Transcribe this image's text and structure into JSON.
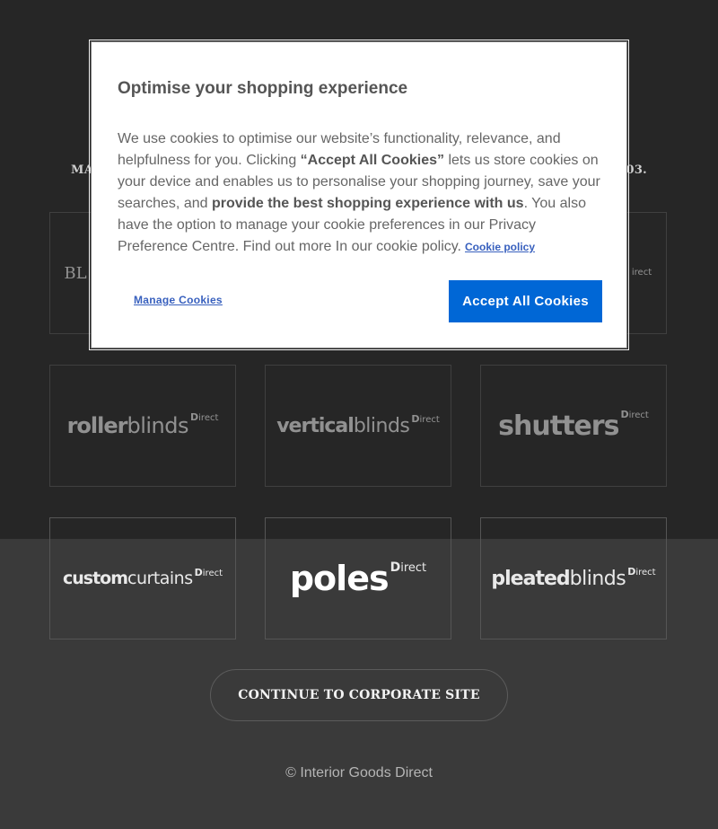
{
  "intro": {
    "left_fragment": "MA",
    "right_fragment": "03."
  },
  "brands": [
    {
      "strong": "BL",
      "light": "",
      "direct": "",
      "dim": true
    },
    {
      "strong": "",
      "light": "",
      "direct": "irect",
      "dim": true
    },
    {
      "strong": "roller",
      "light": "blinds",
      "direct": "irect",
      "dim": true
    },
    {
      "strong": "vertical",
      "light": "blinds",
      "direct": "irect",
      "dim": true
    },
    {
      "strong": "shutters",
      "light": "",
      "direct": "irect",
      "dim": true
    },
    {
      "strong": "custom",
      "light": "curtains",
      "direct": "irect",
      "dim": false
    },
    {
      "strong": "poles",
      "light": "",
      "direct": "irect",
      "dim": false
    },
    {
      "strong": "pleated",
      "light": "blinds",
      "direct": "irect",
      "dim": false
    }
  ],
  "continue_label": "CONTINUE TO CORPORATE SITE",
  "footer_copyright": "© Interior Goods Direct",
  "cookie_banner": {
    "title": "Optimise your shopping experience",
    "text_1": "We use cookies to optimise our website’s functionality, relevance, and helpfulness for you. Clicking ",
    "bold_1": "“Accept All Cookies”",
    "text_2": " lets us store cookies on your device and enables us to personalise your shopping journey, save your searches, and ",
    "bold_2": "provide the best shopping experience with us",
    "text_3": ". You also have the option to manage your cookie preferences in our Privacy Preference Centre. Find out more In our cookie policy.",
    "policy_link": "Cookie policy",
    "manage_label": "Manage Cookies",
    "accept_label": "Accept All Cookies"
  },
  "colors": {
    "accent": "#0067d6",
    "link": "#3860be",
    "overlay": "#262626",
    "background": "#3a3a3a"
  }
}
